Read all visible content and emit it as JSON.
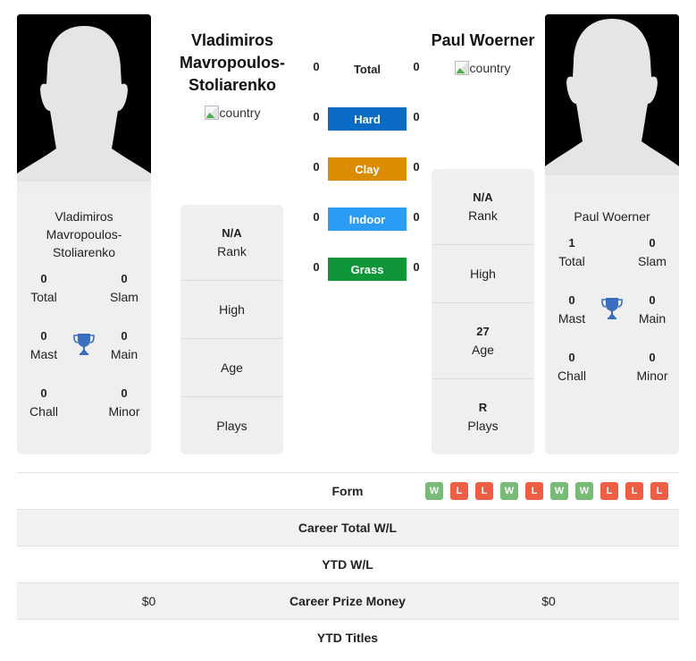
{
  "player1": {
    "name_lines": [
      "Vladimiros",
      "Mavropoulos-",
      "Stoliarenko"
    ],
    "country_alt": "country",
    "card_name_lines": [
      "Vladimiros",
      "Mavropoulos-",
      "Stoliarenko"
    ],
    "titles": {
      "total": {
        "value": "0",
        "label": "Total"
      },
      "slam": {
        "value": "0",
        "label": "Slam"
      },
      "mast": {
        "value": "0",
        "label": "Mast"
      },
      "main": {
        "value": "0",
        "label": "Main"
      },
      "chall": {
        "value": "0",
        "label": "Chall"
      },
      "minor": {
        "value": "0",
        "label": "Minor"
      }
    },
    "stats": [
      {
        "value": "N/A",
        "label": "Rank"
      },
      {
        "value": "",
        "label": "High"
      },
      {
        "value": "",
        "label": "Age"
      },
      {
        "value": "",
        "label": "Plays"
      }
    ]
  },
  "player2": {
    "name": "Paul Woerner",
    "country_alt": "country",
    "card_name": "Paul Woerner",
    "titles": {
      "total": {
        "value": "1",
        "label": "Total"
      },
      "slam": {
        "value": "0",
        "label": "Slam"
      },
      "mast": {
        "value": "0",
        "label": "Mast"
      },
      "main": {
        "value": "0",
        "label": "Main"
      },
      "chall": {
        "value": "0",
        "label": "Chall"
      },
      "minor": {
        "value": "0",
        "label": "Minor"
      }
    },
    "stats": [
      {
        "value": "N/A",
        "label": "Rank"
      },
      {
        "value": "",
        "label": "High"
      },
      {
        "value": "27",
        "label": "Age"
      },
      {
        "value": "R",
        "label": "Plays"
      }
    ]
  },
  "surfaces": [
    {
      "label": "Total",
      "left": "0",
      "right": "0",
      "color": ""
    },
    {
      "label": "Hard",
      "left": "0",
      "right": "0",
      "color": "#0a6cc4"
    },
    {
      "label": "Clay",
      "left": "0",
      "right": "0",
      "color": "#dc8c00"
    },
    {
      "label": "Indoor",
      "left": "0",
      "right": "0",
      "color": "#2b9cf5"
    },
    {
      "label": "Grass",
      "left": "0",
      "right": "0",
      "color": "#0e9638"
    }
  ],
  "comparison": {
    "form_label": "Form",
    "form": [
      "W",
      "L",
      "L",
      "W",
      "L",
      "W",
      "W",
      "L",
      "L",
      "L"
    ],
    "form_colors": {
      "W": "#77bb77",
      "L": "#ee5e45"
    },
    "rows": [
      {
        "label": "Career Total W/L",
        "left": "",
        "right": ""
      },
      {
        "label": "YTD W/L",
        "left": "",
        "right": ""
      },
      {
        "label": "Career Prize Money",
        "left": "$0",
        "right": "$0"
      },
      {
        "label": "YTD Titles",
        "left": "",
        "right": ""
      }
    ]
  },
  "colors": {
    "trophy": "#3a6fc0",
    "card_bg": "#efefef"
  }
}
